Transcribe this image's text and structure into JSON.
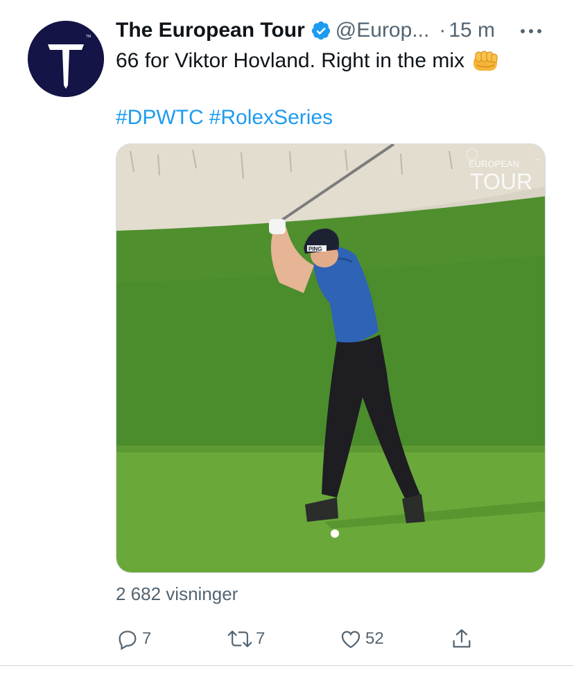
{
  "colors": {
    "accent": "#1d9bf0",
    "text_primary": "#0f1419",
    "text_secondary": "#536471",
    "avatar_bg": "#141446",
    "verified": "#1d9bf0"
  },
  "tweet": {
    "avatar": {
      "icon": "european-tour-logo"
    },
    "display_name": "The European Tour",
    "verified_icon": "verified-badge-icon",
    "handle": "@Europ...",
    "separator": "·",
    "time": "15 m",
    "more_icon": "more-horizontal-icon",
    "text": "66 for Viktor Hovland. Right in the mix",
    "emoji": "oncoming-fist-emoji",
    "hashtags": [
      "#DPWTC",
      "#RolexSeries"
    ],
    "media": {
      "type": "video",
      "description_icon": "golf-swing-video",
      "watermark_line1": "EUROPEAN",
      "watermark_tm": "™",
      "watermark_line2": "TOUR",
      "cap_logo": "PING"
    },
    "views": "2 682 visninger",
    "actions": {
      "reply": {
        "icon": "reply-icon",
        "count": "7"
      },
      "retweet": {
        "icon": "retweet-icon",
        "count": "7"
      },
      "like": {
        "icon": "heart-icon",
        "count": "52"
      },
      "share": {
        "icon": "share-icon"
      }
    }
  }
}
